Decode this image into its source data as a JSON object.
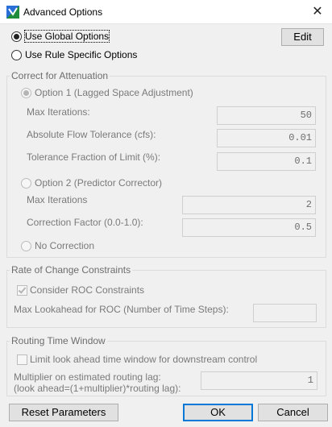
{
  "window": {
    "title": "Advanced Options",
    "icon": "app-icon",
    "close": "✕"
  },
  "options": {
    "global_label": "Use Global Options",
    "global_selected": true,
    "rule_label": "Use Rule Specific Options",
    "edit_label": "Edit"
  },
  "attenuation": {
    "legend": "Correct for Attenuation",
    "option1": {
      "label": "Option 1 (Lagged Space Adjustment)",
      "selected": true,
      "max_iterations_label": "Max Iterations:",
      "max_iterations_value": "50",
      "flow_tolerance_label": "Absolute Flow Tolerance (cfs):",
      "flow_tolerance_value": "0.01",
      "tolerance_fraction_label": "Tolerance Fraction of Limit (%):",
      "tolerance_fraction_value": "0.1"
    },
    "option2": {
      "label": "Option 2 (Predictor Corrector)",
      "max_iterations_label": "Max Iterations",
      "max_iterations_value": "2",
      "correction_factor_label": "Correction Factor (0.0-1.0):",
      "correction_factor_value": "0.5"
    },
    "no_correction_label": "No Correction"
  },
  "roc": {
    "legend": "Rate of Change Constraints",
    "consider_label": "Consider ROC Constraints",
    "consider_checked": true,
    "max_lookahead_label": "Max Lookahead for ROC (Number of Time Steps):",
    "max_lookahead_value": ""
  },
  "routing": {
    "legend": "Routing Time Window",
    "limit_label": "Limit look ahead time window for downstream control",
    "limit_checked": false,
    "multiplier_label_1": "Multiplier on estimated routing lag:",
    "multiplier_label_2": "(look ahead=(1+multiplier)*routing lag):",
    "multiplier_value": "1"
  },
  "buttons": {
    "reset": "Reset Parameters",
    "ok": "OK",
    "cancel": "Cancel"
  },
  "colors": {
    "accent": "#0078d7",
    "disabled_text": "#7a7a7a",
    "background": "#f0f0f0"
  }
}
